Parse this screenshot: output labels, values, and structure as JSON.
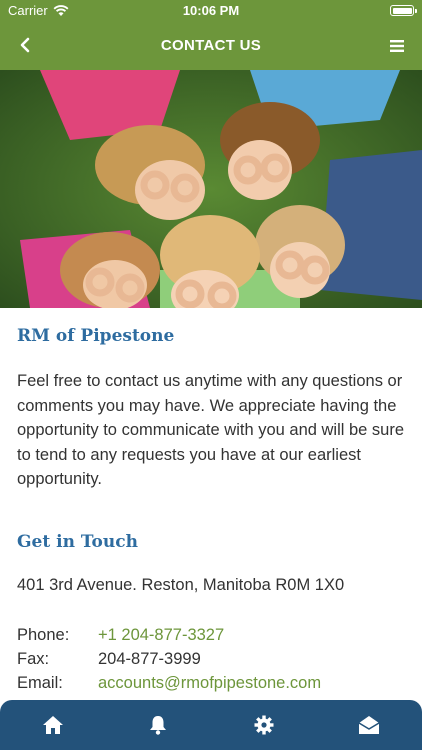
{
  "status_bar": {
    "carrier": "Carrier",
    "time": "10:06 PM"
  },
  "nav": {
    "title": "CONTACT US"
  },
  "content": {
    "org_name": "RM of Pipestone",
    "intro": "Feel free to contact us anytime with any questions or comments you may have. We appreciate having the opportunity to communicate with you and will be sure to tend to any requests you have at our earliest opportunity.",
    "section_title": "Get in Touch",
    "address": "401 3rd Avenue. Reston, Manitoba R0M 1X0",
    "contacts": {
      "phone_label": "Phone:",
      "phone": "+1 204-877-3327",
      "fax_label": "Fax:",
      "fax": "204-877-3999",
      "email_label": "Email:",
      "email": "accounts@rmofpipestone.com"
    }
  },
  "tabs": [
    {
      "icon": "home-icon"
    },
    {
      "icon": "bell-icon"
    },
    {
      "icon": "gear-icon"
    },
    {
      "icon": "mail-open-icon"
    }
  ],
  "colors": {
    "brand_green": "#6d963b",
    "heading_blue": "#2e6ca0",
    "tab_bar": "#23527a"
  }
}
